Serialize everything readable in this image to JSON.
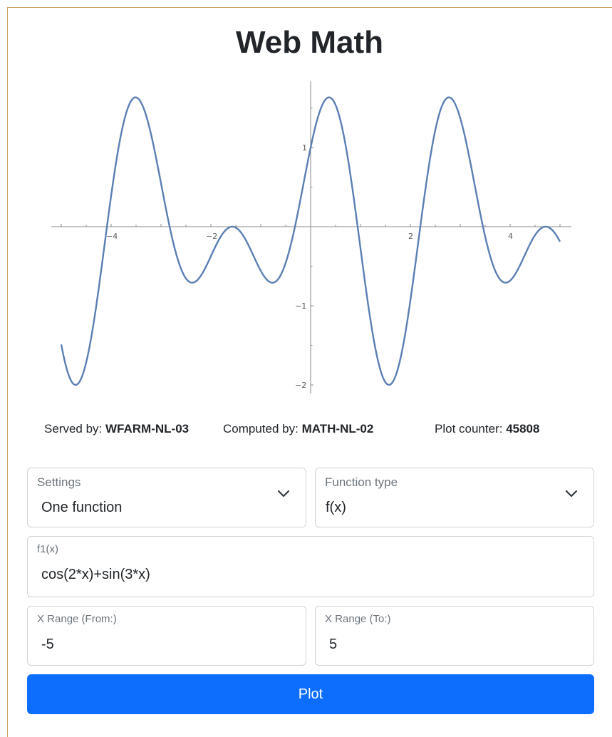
{
  "app": {
    "title": "Web Math"
  },
  "plot": {
    "function": "cos(2*x)+sin(3*x)",
    "line_color": "#5b7fb4",
    "x_tick_labels": [
      "-4",
      "-2",
      "2",
      "4"
    ],
    "y_tick_labels": [
      "1",
      "-1",
      "-2"
    ]
  },
  "info": {
    "served_label": "Served by:",
    "served_value": "WFARM-NL-03",
    "computed_label": "Computed by:",
    "computed_value": "MATH-NL-02",
    "counter_label": "Plot counter:",
    "counter_value": "45808"
  },
  "form": {
    "settings": {
      "label": "Settings",
      "value": "One function"
    },
    "function_type": {
      "label": "Function type",
      "value": "f(x)"
    },
    "f1": {
      "label": "f1(x)",
      "value": "cos(2*x)+sin(3*x)"
    },
    "x_from": {
      "label": "X Range (From:)",
      "value": "-5"
    },
    "x_to": {
      "label": "X Range (To:)",
      "value": "5"
    },
    "plot_button": "Plot"
  },
  "colors": {
    "accent": "#0d6efd",
    "border": "#ced4da",
    "frame": "#cf9d6a"
  }
}
